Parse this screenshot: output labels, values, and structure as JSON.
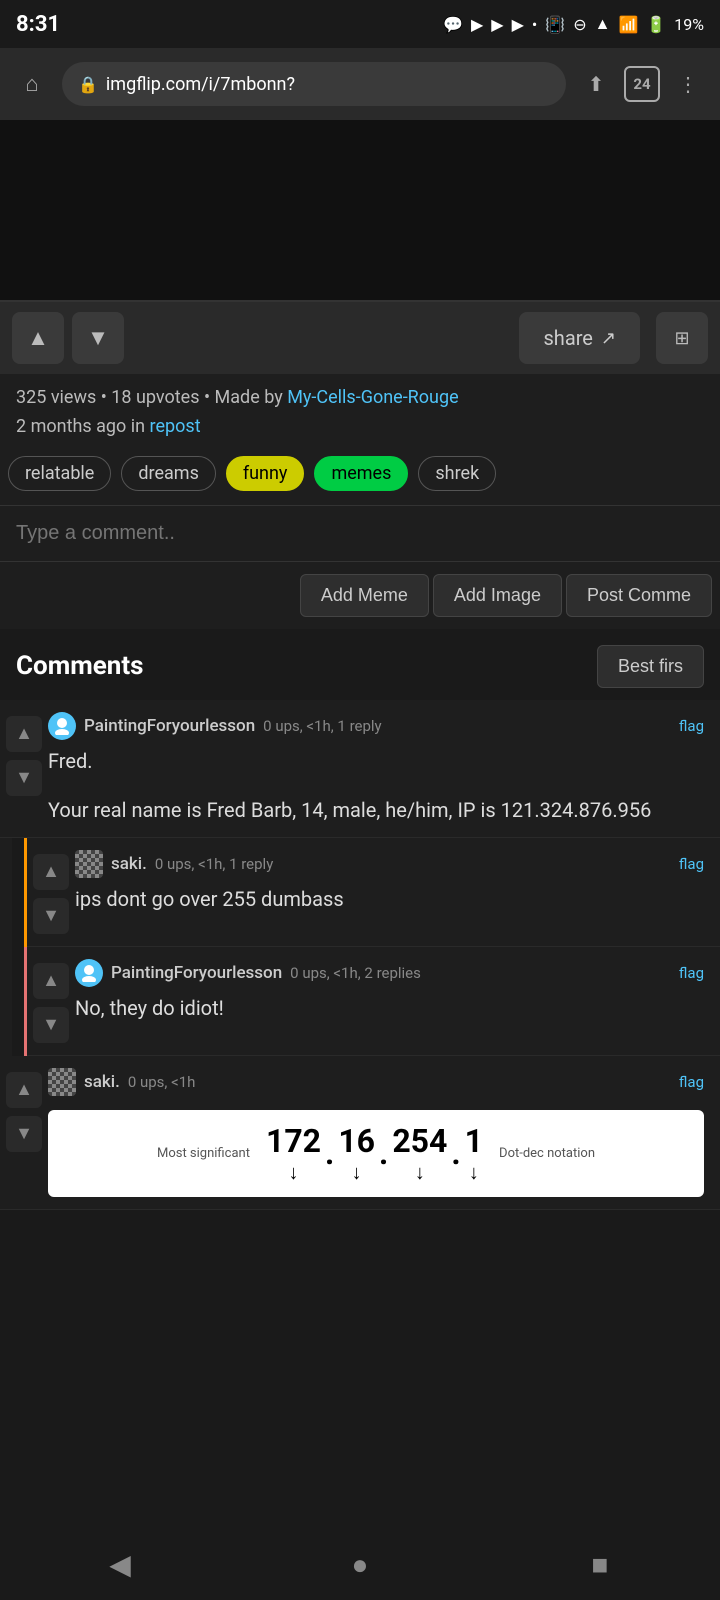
{
  "statusBar": {
    "time": "8:31",
    "tabCount": "24",
    "battery": "19%"
  },
  "browserToolbar": {
    "url": "imgflip.com/i/7mbonn?",
    "homeIcon": "⌂",
    "lockIcon": "🔒",
    "shareIcon": "⬆",
    "moreIcon": "⋮"
  },
  "postMeta": {
    "views": "325 views",
    "upvotes": "18 upvotes",
    "madeByLabel": "Made by",
    "username": "My-Cells-Gone-Rouge",
    "timeAgo": "2 months ago in",
    "channel": "repost"
  },
  "tags": [
    {
      "label": "relatable",
      "style": "plain"
    },
    {
      "label": "dreams",
      "style": "plain"
    },
    {
      "label": "funny",
      "style": "funny"
    },
    {
      "label": "memes",
      "style": "memes"
    },
    {
      "label": "shrek",
      "style": "plain"
    }
  ],
  "commentInput": {
    "placeholder": "Type a comment.."
  },
  "commentActions": {
    "addMeme": "Add Meme",
    "addImage": "Add Image",
    "postComment": "Post Comme"
  },
  "commentsSection": {
    "title": "Comments",
    "sortLabel": "Best firs"
  },
  "comments": [
    {
      "id": 1,
      "username": "PaintingForyourlesson",
      "stats": "0 ups, <1h, 1 reply",
      "flagText": "flag",
      "avatarType": "blue",
      "text1": "Fred.",
      "text2": "Your real name is Fred Barb, 14, male, he/him, IP is 121.324.876.956",
      "indent": "none"
    },
    {
      "id": 2,
      "username": "saki.",
      "stats": "0 ups, <1h, 1 reply",
      "flagText": "flag",
      "avatarType": "checker",
      "text1": "ips dont go over 255 dumbass",
      "text2": "",
      "indent": "orange"
    },
    {
      "id": 3,
      "username": "PaintingForyourlesson",
      "stats": "0 ups, <1h, 2 replies",
      "flagText": "flag",
      "avatarType": "blue",
      "text1": "No, they do idiot!",
      "text2": "",
      "indent": "red"
    },
    {
      "id": 4,
      "username": "saki.",
      "stats": "0 ups, <1h",
      "flagText": "flag",
      "avatarType": "checker",
      "text1": "",
      "text2": "",
      "indent": "none",
      "hasIpDiagram": true
    }
  ],
  "ipDiagram": {
    "label": "Most significant",
    "num1": "172",
    "num2": "16",
    "num3": "254",
    "num4": "1",
    "dotDecLabel": "Dot-dec notation"
  },
  "navBar": {
    "back": "◀",
    "home": "●",
    "square": "■"
  },
  "voteBar": {
    "shareLabel": "share"
  }
}
